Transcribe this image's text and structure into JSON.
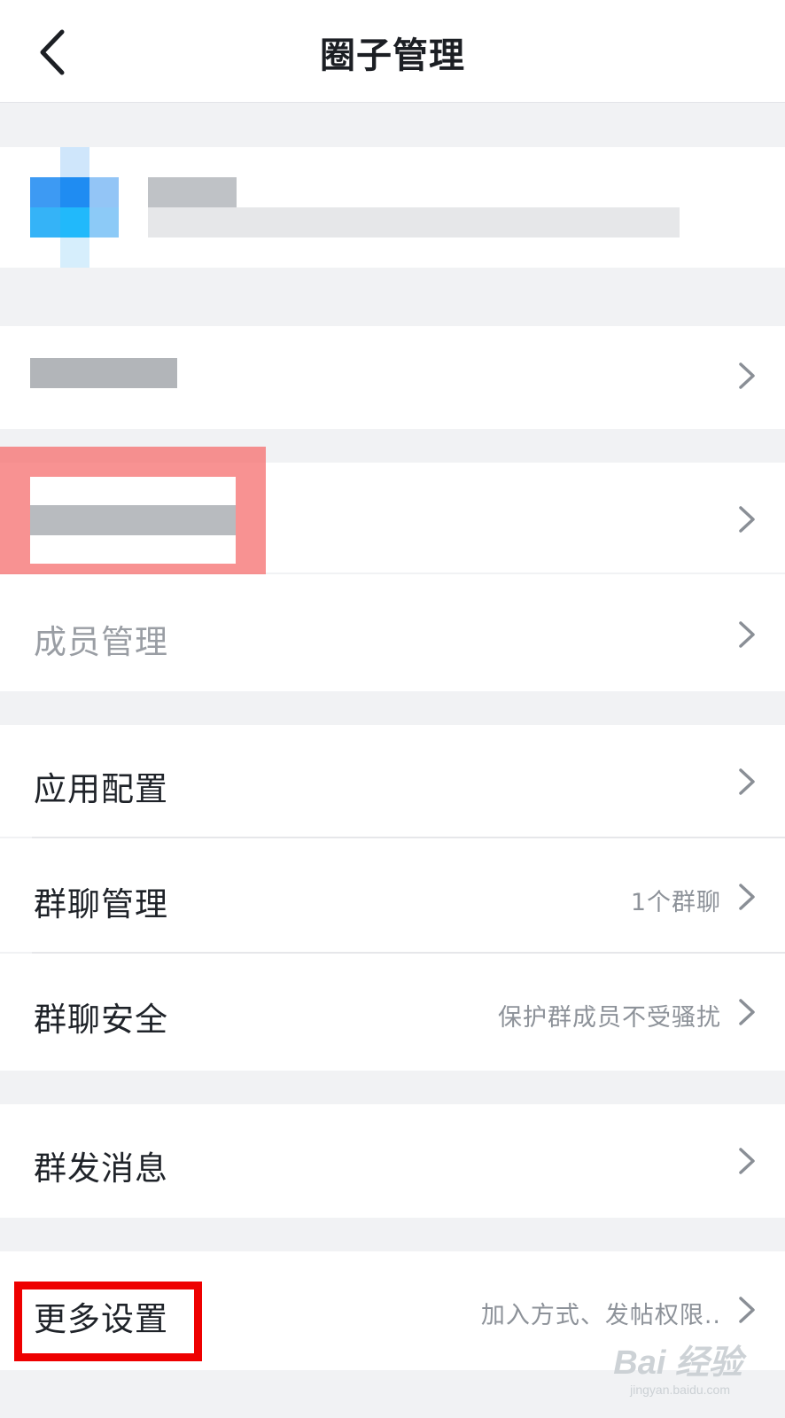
{
  "header": {
    "title": "圈子管理",
    "back_icon": "chevron-left-icon"
  },
  "rows": {
    "member_management": {
      "label": "成员管理"
    },
    "app_config": {
      "label": "应用配置"
    },
    "group_chat_management": {
      "label": "群聊管理",
      "value": "1个群聊"
    },
    "group_chat_security": {
      "label": "群聊安全",
      "value": "保护群成员不受骚扰"
    },
    "broadcast_message": {
      "label": "群发消息"
    },
    "more_settings": {
      "label": "更多设置",
      "value": "加入方式、发帖权限.."
    }
  },
  "watermark": {
    "logo": "Bai 经验",
    "url": "jingyan.baidu.com"
  },
  "colors": {
    "background": "#f1f2f4",
    "card": "#ffffff",
    "primary_text": "#1f2329",
    "secondary_text": "#8d9299",
    "highlight_red": "#ee0000",
    "highlight_soft": "#f56e6e"
  }
}
